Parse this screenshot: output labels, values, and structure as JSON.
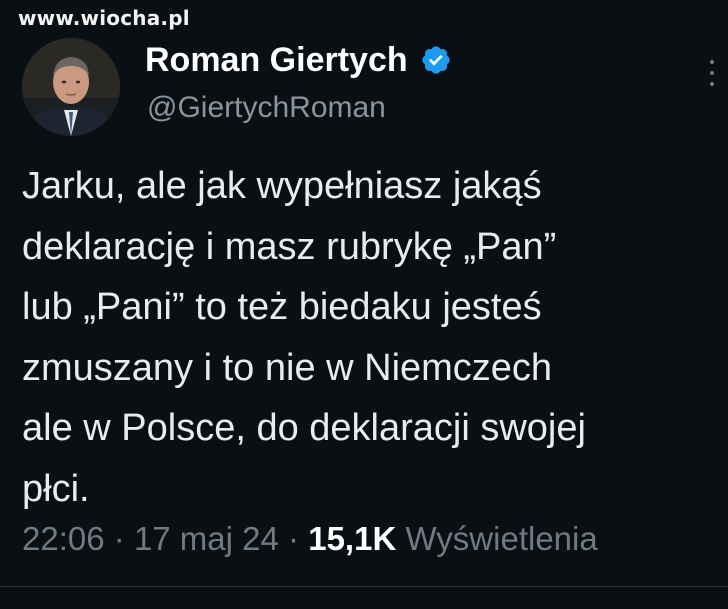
{
  "watermark": "www.wiocha.pl",
  "author": {
    "name": "Roman Giertych",
    "handle": "@GiertychRoman",
    "verified": true,
    "verified_color": "#1d9bf0"
  },
  "tweet": {
    "lines": [
      "Jarku, ale jak wypełniasz jakąś",
      "deklarację i masz rubrykę „Pan”",
      "lub „Pani” to też biedaku jesteś",
      "zmuszany i to nie w Niemczech",
      "ale w Polsce, do deklaracji swojej",
      "płci."
    ]
  },
  "meta": {
    "time": "22:06",
    "separator": "·",
    "date": "17 maj 24",
    "views_count": "15,1K",
    "views_label": "Wyświetlenia"
  },
  "icons": {
    "verified": "verified-badge-icon",
    "more": "more-options-icon"
  }
}
